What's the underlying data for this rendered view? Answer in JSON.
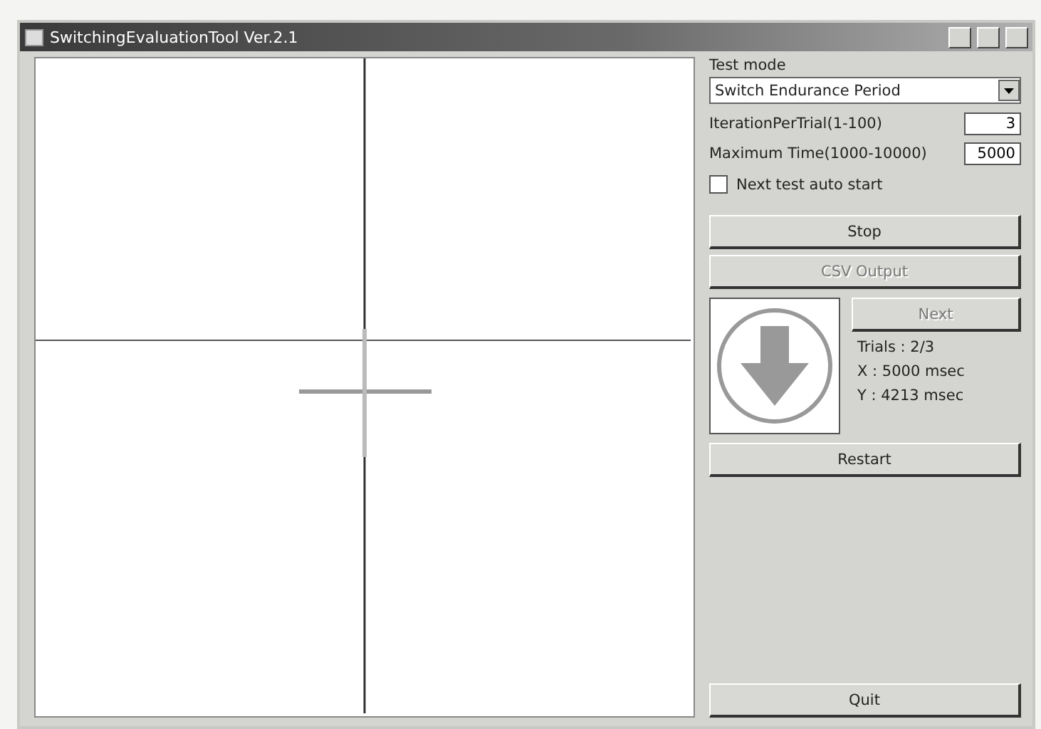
{
  "window": {
    "title": "SwitchingEvaluationTool Ver.2.1"
  },
  "panel": {
    "test_mode_label": "Test mode",
    "test_mode": "Switch Endurance Period",
    "fields": [
      {
        "label": "IterationPerTrial(1-100)",
        "value": "3"
      },
      {
        "label": "Maximum Time(1000-10000)",
        "value": "5000"
      }
    ],
    "auto_start": {
      "label": "Next test auto start",
      "checked": false
    },
    "stop_button": {
      "label": "Stop",
      "disabled": false
    },
    "csv_button": {
      "label": "CSV Output",
      "disabled": true
    },
    "next_button": {
      "label": "Next",
      "disabled": true
    },
    "readouts": [
      "Trials : 2/3",
      "X : 5000 msec",
      "Y : 4213 msec"
    ],
    "restart_button": {
      "label": "Restart",
      "disabled": false
    },
    "quit_button": {
      "label": "Quit",
      "disabled": false
    }
  }
}
